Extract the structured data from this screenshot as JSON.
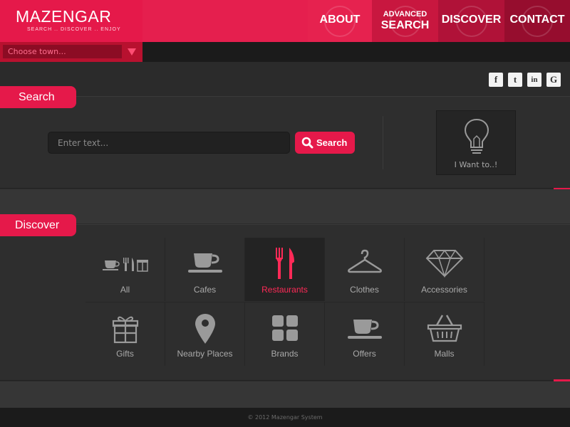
{
  "brand": {
    "name": "MAZENGAR",
    "tagline": "SEARCH .. DISCOVER .. ENJOY"
  },
  "nav": {
    "about": "ABOUT",
    "advanced_line1": "ADVANCED",
    "advanced_line2": "SEARCH",
    "discover": "DISCOVER",
    "contact": "CONTACT"
  },
  "town_select": {
    "value": "Choose town..."
  },
  "social": {
    "facebook": "f",
    "twitter": "t",
    "linkedin": "in",
    "google": "G"
  },
  "search_section": {
    "title": "Search",
    "input_placeholder": "Enter text...",
    "button_label": "Search",
    "want_label": "I Want to..!"
  },
  "discover_section": {
    "title": "Discover",
    "categories": [
      {
        "label": "All",
        "icon": "all-categories-icon"
      },
      {
        "label": "Cafes",
        "icon": "coffee-cup-icon"
      },
      {
        "label": "Restaurants",
        "icon": "fork-knife-icon",
        "active": true
      },
      {
        "label": "Clothes",
        "icon": "hanger-icon"
      },
      {
        "label": "Accessories",
        "icon": "diamond-icon"
      },
      {
        "label": "Gifts",
        "icon": "gift-icon"
      },
      {
        "label": "Nearby Places",
        "icon": "map-pin-icon"
      },
      {
        "label": "Brands",
        "icon": "grid-squares-icon"
      },
      {
        "label": "Offers",
        "icon": "coffee-cup-icon"
      },
      {
        "label": "Malls",
        "icon": "shopping-basket-icon"
      }
    ]
  },
  "footer": {
    "copyright": "© 2012 Mazengar System"
  },
  "colors": {
    "accent": "#e5194a",
    "background": "#2b2b2b",
    "active_text": "#ff2a57"
  }
}
